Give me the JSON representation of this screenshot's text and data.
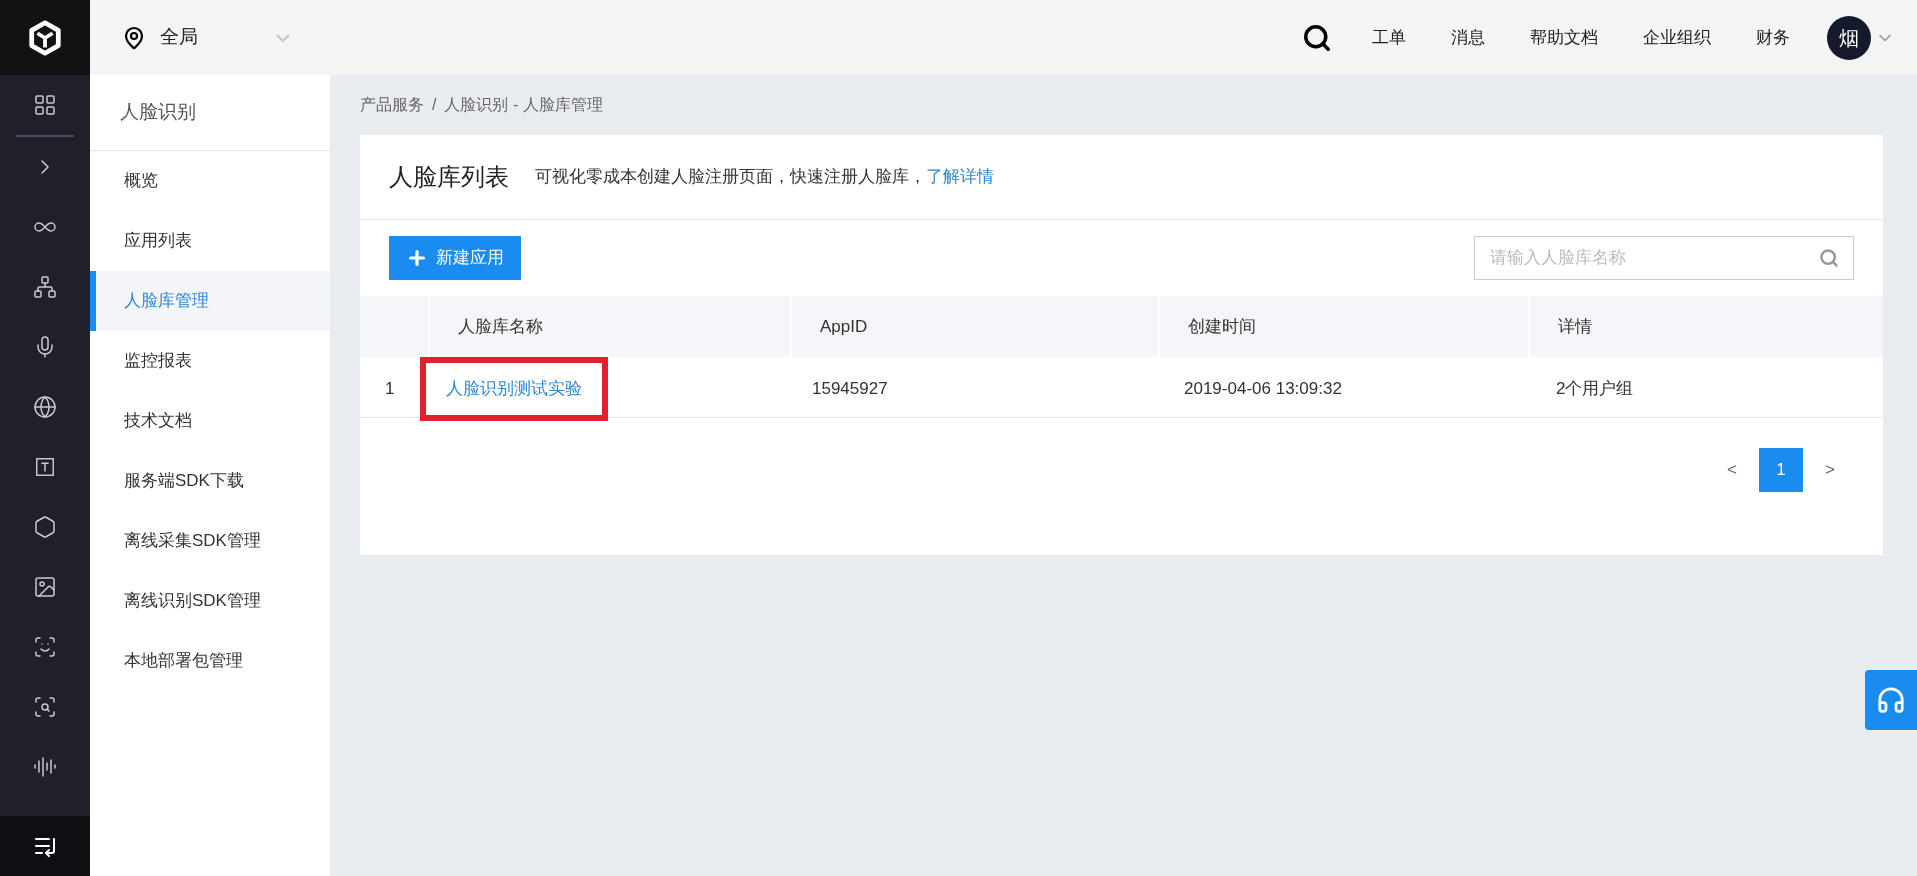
{
  "topbar": {
    "region": "全局",
    "links": [
      "工单",
      "消息",
      "帮助文档",
      "企业组织",
      "财务"
    ],
    "avatar": "烟"
  },
  "sidebar": {
    "title": "人脸识别",
    "items": [
      {
        "label": "概览",
        "selected": false
      },
      {
        "label": "应用列表",
        "selected": false
      },
      {
        "label": "人脸库管理",
        "selected": true
      },
      {
        "label": "监控报表",
        "selected": false
      },
      {
        "label": "技术文档",
        "selected": false
      },
      {
        "label": "服务端SDK下载",
        "selected": false
      },
      {
        "label": "离线采集SDK管理",
        "selected": false
      },
      {
        "label": "离线识别SDK管理",
        "selected": false
      },
      {
        "label": "本地部署包管理",
        "selected": false
      }
    ]
  },
  "breadcrumb": [
    "产品服务",
    "/",
    "人脸识别 - 人脸库管理"
  ],
  "card": {
    "title": "人脸库列表",
    "description": "可视化零成本创建人脸注册页面，快速注册人脸库，",
    "link": "了解详情",
    "new_button": "新建应用",
    "search": {
      "placeholder": "请输入人脸库名称"
    },
    "table": {
      "columns": [
        "人脸库名称",
        "AppID",
        "创建时间",
        "详情"
      ],
      "rows": [
        {
          "index": "1",
          "name": "人脸识别测试实验",
          "highlighted": true,
          "appid": "15945927",
          "created": "2019-04-06 13:09:32",
          "details": "2个用户组"
        }
      ]
    },
    "pagination": {
      "prev": "<",
      "pages": [
        {
          "label": "1",
          "selected": true
        }
      ],
      "next": ">"
    }
  }
}
